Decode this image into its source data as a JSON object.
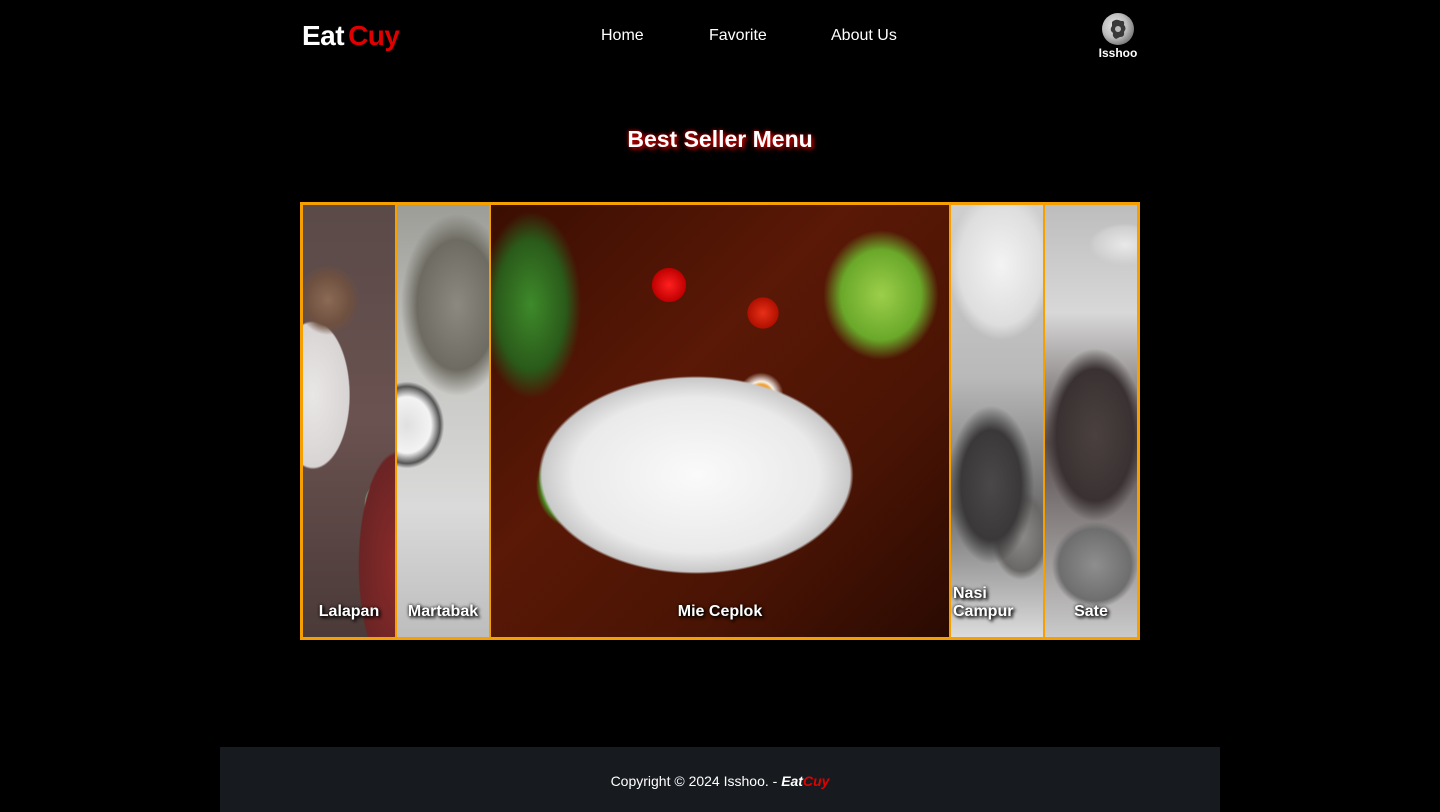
{
  "header": {
    "brand_eat": "Eat",
    "brand_cuy": "Cuy",
    "nav": {
      "home": "Home",
      "favorite": "Favorite",
      "about": "About Us"
    },
    "profile_name": "Isshoo"
  },
  "main": {
    "title": "Best Seller Menu",
    "menu_items": [
      {
        "label": "Lalapan"
      },
      {
        "label": "Martabak"
      },
      {
        "label": "Mie Ceplok"
      },
      {
        "label": "Nasi Campur"
      },
      {
        "label": "Sate"
      }
    ]
  },
  "footer": {
    "copyright": "Copyright © 2024 Isshoo. - ",
    "brand_eat": "Eat",
    "brand_cuy": "Cuy"
  },
  "colors": {
    "background": "#000000",
    "accent_red": "#e00000",
    "gallery_border": "#f5a000",
    "footer_bg": "#171b1f"
  }
}
